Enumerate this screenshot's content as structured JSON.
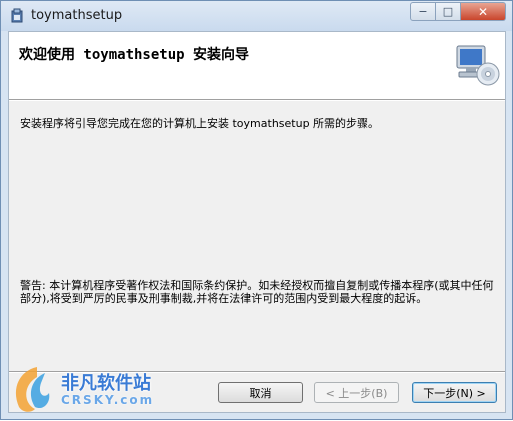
{
  "window": {
    "title": "toymathsetup",
    "icon": "installer-icon",
    "controls": {
      "minimize": "−",
      "maximize": "□",
      "close": "✕"
    }
  },
  "header": {
    "title": "欢迎使用 toymathsetup 安装向导",
    "icon": "computer-disc-icon"
  },
  "body": {
    "description": "安装程序将引导您完成在您的计算机上安装 toymathsetup 所需的步骤。",
    "warning": "警告: 本计算机程序受著作权法和国际条约保护。如未经授权而擅自复制或传播本程序(或其中任何部分),将受到严厉的民事及刑事制裁,并将在法律许可的范围内受到最大程度的起诉。"
  },
  "buttons": {
    "cancel": "取消",
    "back": "< 上一步(B)",
    "next": "下一步(N) >"
  },
  "watermark": {
    "text": "非凡软件站",
    "sub": "CRSKY.com"
  }
}
